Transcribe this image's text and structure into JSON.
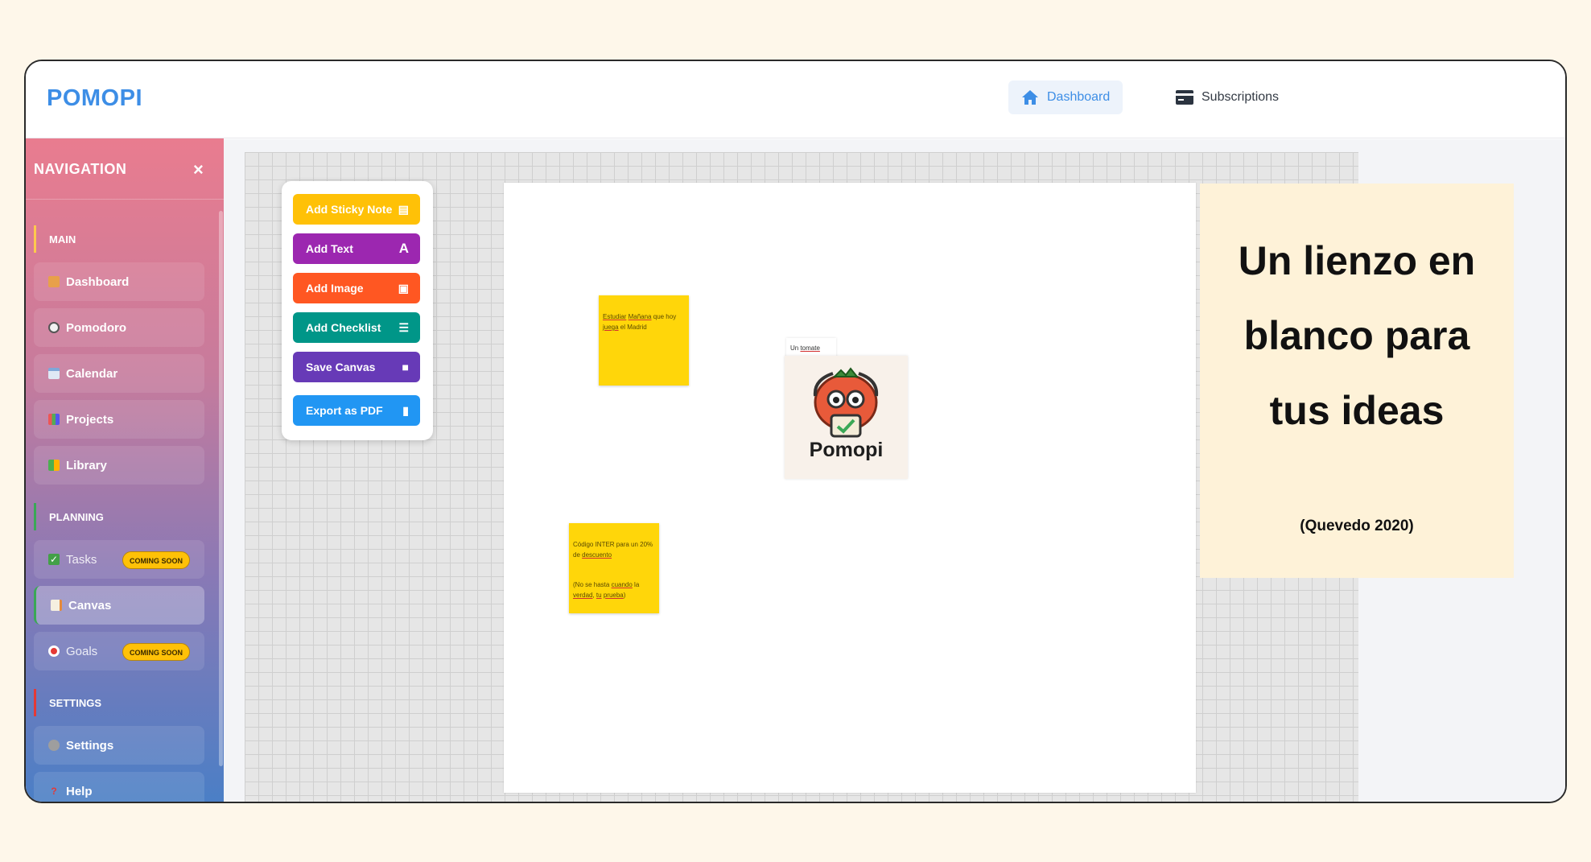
{
  "app": {
    "logo": "POMOPI"
  },
  "topnav": {
    "dashboard": "Dashboard",
    "subscriptions": "Subscriptions"
  },
  "sidebar": {
    "title": "NAVIGATION",
    "close": "×",
    "sections": {
      "main": "MAIN",
      "planning": "PLANNING",
      "settings": "SETTINGS"
    },
    "items": {
      "dashboard": "Dashboard",
      "pomodoro": "Pomodoro",
      "calendar": "Calendar",
      "projects": "Projects",
      "library": "Library",
      "tasks": "Tasks",
      "canvas": "Canvas",
      "goals": "Goals",
      "settings": "Settings",
      "help": "Help"
    },
    "badge": "COMING SOON"
  },
  "toolbox": {
    "sticky": "Add Sticky Note",
    "text": "Add Text",
    "image": "Add Image",
    "checklist": "Add Checklist",
    "save": "Save Canvas",
    "export": "Export as PDF"
  },
  "canvas": {
    "note1": {
      "a": "Estudiar",
      "b": "Mañana",
      "c": " que hoy ",
      "d": "juega",
      "e": " el Madrid"
    },
    "note2": {
      "line1": "Código INTER para un 20% de ",
      "line1u": "descuento",
      "line2a": "(No se hasta ",
      "line2b": "cuando",
      "line2c": " la ",
      "line2d": "verdad",
      "line2e": ", ",
      "line2f": "tu",
      "line2g": " ",
      "line2h": "prueba",
      "line2i": ")"
    },
    "textbox": {
      "a": "Un ",
      "b": "tomate"
    },
    "image_logo": "Pomopi"
  },
  "promo": {
    "line1": "Un lienzo en",
    "line2": "blanco para",
    "line3": "tus ideas",
    "sub": "(Quevedo 2020)"
  },
  "colors": {
    "brand": "#3d8ee6",
    "sticky_btn": "#ffc107",
    "text_btn": "#9c27b0",
    "image_btn": "#ff5722",
    "checklist_btn": "#009688",
    "save_btn": "#673ab7",
    "export_btn": "#2196f3",
    "sticky_note": "#ffd60a"
  }
}
